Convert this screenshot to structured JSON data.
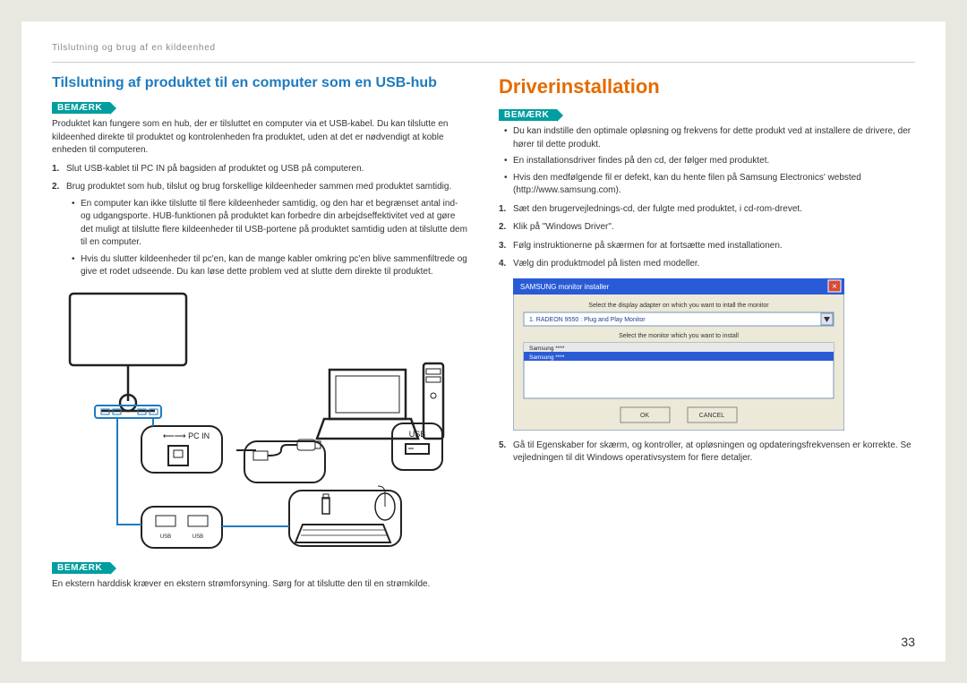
{
  "header": {
    "breadcrumb": "Tilslutning og brug af en kildeenhed"
  },
  "left": {
    "title": "Tilslutning af produktet til en computer som en USB-hub",
    "note_label": "BEMÆRK",
    "intro": "Produktet kan fungere som en hub, der er tilsluttet en computer via et USB-kabel. Du kan tilslutte en kildeenhed direkte til produktet og kontrolenheden fra produktet, uden at det er nødvendigt at koble enheden til computeren.",
    "steps": [
      {
        "num": "1.",
        "text": "Slut USB-kablet til PC IN på bagsiden af produktet og USB på computeren."
      },
      {
        "num": "2.",
        "text": "Brug produktet som hub, tilslut og brug forskellige kildeenheder sammen med produktet samtidig.",
        "bullets": [
          "En computer kan ikke tilslutte til flere kildeenheder samtidig, og den har et begrænset antal ind- og udgangsporte. HUB-funktionen på produktet kan forbedre din arbejdseffektivitet ved at gøre det muligt at tilslutte flere kildeenheder til USB-portene på produktet samtidig uden at tilslutte dem til en computer.",
          "Hvis du slutter kildeenheder til pc'en, kan de mange kabler omkring pc'en blive sammenfiltrede og give et rodet udseende. Du kan løse dette problem ved at slutte dem direkte til produktet."
        ]
      }
    ],
    "diagram": {
      "pc_in_label": "PC IN",
      "usb_label": "USB",
      "usb_small": "USB"
    },
    "bottom_note_label": "BEMÆRK",
    "bottom_note": "En ekstern harddisk kræver en ekstern strømforsyning. Sørg for at tilslutte den til en strømkilde."
  },
  "right": {
    "title": "Driverinstallation",
    "note_label": "BEMÆRK",
    "bullets": [
      "Du kan indstille den optimale opløsning og frekvens for dette produkt ved at installere de drivere, der hører til dette produkt.",
      "En installationsdriver findes på den cd, der følger med produktet.",
      "Hvis den medfølgende fil er defekt, kan du hente filen på Samsung Electronics' websted (http://www.samsung.com)."
    ],
    "steps": [
      {
        "num": "1.",
        "text": "Sæt den brugervejlednings-cd, der fulgte med produktet, i cd-rom-drevet."
      },
      {
        "num": "2.",
        "text": "Klik på \"Windows Driver\"."
      },
      {
        "num": "3.",
        "text": "Følg instruktionerne på skærmen for at fortsætte med installationen."
      },
      {
        "num": "4.",
        "text": "Vælg din produktmodel på listen med modeller."
      },
      {
        "num": "5.",
        "text": "Gå til Egenskaber for skærm, og kontroller, at opløsningen og opdateringsfrekvensen er korrekte. Se vejledningen til dit Windows operativsystem for flere detaljer."
      }
    ],
    "installer": {
      "titlebar": "SAMSUNG monitor installer",
      "line1": "Select the display adapter on which you want to intall the monitor",
      "adapter": "1. RADEON 9550 : Plug and Play Monitor",
      "line2": "Select the monitor which you want to install",
      "item0": "Samsung ****",
      "item1": "Samsung ****",
      "ok": "OK",
      "cancel": "CANCEL"
    }
  },
  "page_number": "33"
}
